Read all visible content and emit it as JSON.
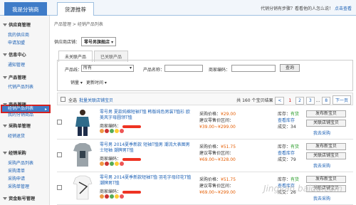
{
  "header": {
    "tab_active": "我是分销商",
    "tab_inactive": "货源推荐",
    "notice": "代销分销有步骤？看看他的人怎么说！",
    "notice_link": "点击查看"
  },
  "sidebar": {
    "groups": [
      {
        "title": "供应商管理",
        "items": [
          "我的供应商",
          "申请加盟"
        ]
      },
      {
        "title": "信息中心",
        "items": [
          "通知管理"
        ]
      },
      {
        "title": "产品管理",
        "items": [
          "代销产品列表",
          "经销产品列表"
        ]
      },
      {
        "title": "商品管理",
        "items": [
          "我的分销商品"
        ]
      },
      {
        "title": "采购单管理",
        "items": [
          "经销退货"
        ]
      },
      {
        "title": "经销采购",
        "items": [
          "采购产品列表",
          "采购清单",
          "采购申请",
          "采购单管理"
        ]
      },
      {
        "title": "资金账号管理",
        "items": []
      }
    ],
    "selected": "经销产品列表"
  },
  "main": {
    "breadcrumb": "产品管理 > 经销产品列表",
    "store_label": "供应商店铺：",
    "store_value": "零号男旗舰店",
    "subtabs": [
      "未关联产品",
      "已关联产品"
    ],
    "search": {
      "category_label": "产品线：",
      "category_value": "所有",
      "name_label": "产品名称：",
      "code_label": "商家编码：",
      "query_btn": "查询",
      "sort_label": "销量",
      "sort2_label": "更新时间"
    },
    "toolbar": {
      "select_all": "全选",
      "batch_link": "批量关联店铺宝贝",
      "total_text": "共 160 个宝贝结果",
      "pages": [
        "1",
        "2",
        "3",
        "...",
        "8"
      ],
      "next": "下一页"
    },
    "products": [
      {
        "title": "零号男 夏款纯棉短袖T恤 韩版纯色男装T恤衫 欧美风字母圆领T恤",
        "code_label": "商家编码：",
        "price_label": "采购价格：",
        "price": "¥29.00",
        "suggest_label": "建议零售价区间：",
        "suggest": "¥39.00~¥299.00",
        "stock_label": "库存：",
        "stock": "有货",
        "link_text": "查看库存",
        "sold": "成交：34",
        "btn1": "发布新宝贝",
        "btn2": "关联店铺宝贝",
        "link2": "我去采购"
      },
      {
        "title": "零号男 2014夏季新款 短袖T恤男 潮流大表图男士短袖 潮牌男T恤",
        "code_label": "商家编码：",
        "price_label": "采购价格：",
        "price": "¥51.75",
        "suggest_label": "建议零售价区间：",
        "suggest": "¥69.00~¥328.00",
        "stock_label": "库存：",
        "stock": "有货",
        "link_text": "查看库存",
        "sold": "成交：79",
        "btn1": "发布新宝贝",
        "btn2": "关联店铺宝贝",
        "link2": "我去采购"
      },
      {
        "title": "零号男 2014夏季新款短袖T恤 羽毛字母印花T恤 潮牌男T恤",
        "code_label": "商家编码：",
        "price_label": "采购价格：",
        "price": "¥51.75",
        "suggest_label": "建议零售价区间：",
        "suggest": "¥69.00~¥299.00",
        "stock_label": "库存：",
        "stock": "有货",
        "link_text": "查看库存",
        "sold": "成交：26",
        "btn1": "发布新宝贝",
        "btn2": "关联店铺宝贝",
        "link2": "我去采购"
      }
    ]
  },
  "watermark": "Jingyan.baidu.com"
}
